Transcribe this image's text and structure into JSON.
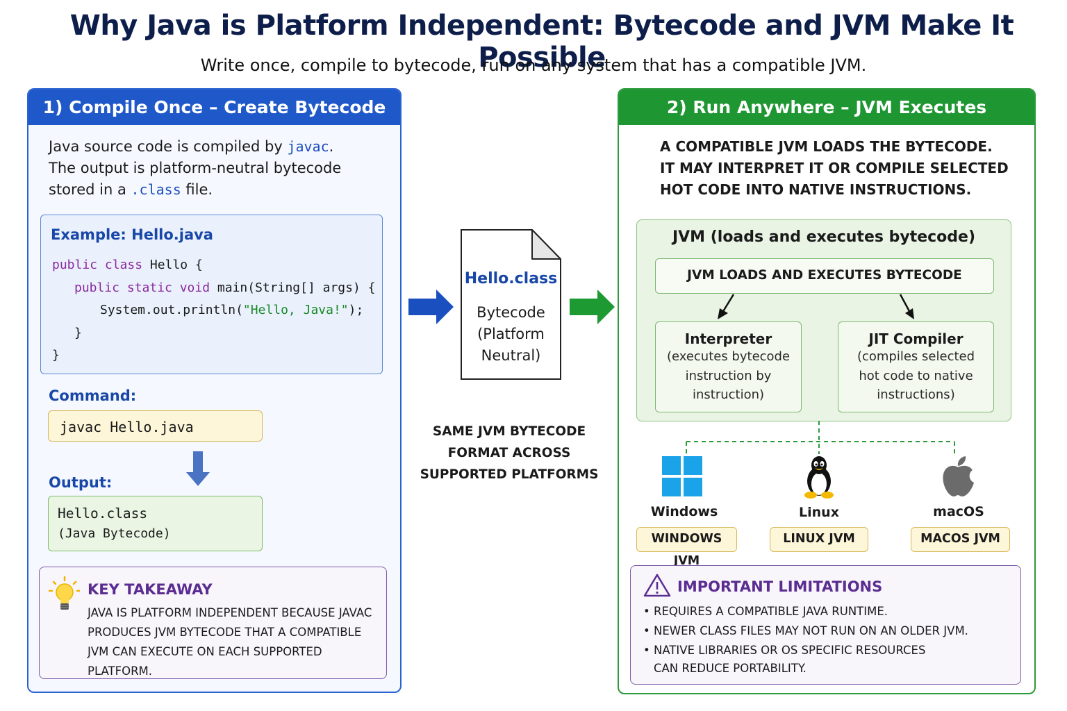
{
  "title": "Why Java is Platform Independent: Bytecode and JVM Make It Possible",
  "subtitle": "Write once, compile to bytecode, run on any system that has a compatible JVM.",
  "left": {
    "header": "1) Compile Once – Create Bytecode",
    "intro": {
      "line1_a": "Java source code is compiled by ",
      "line1_code": "javac",
      "line1_b": ".",
      "line2": "The output is platform-neutral bytecode",
      "line3_a": "stored in a ",
      "line3_code": ".class",
      "line3_b": " file."
    },
    "example": {
      "title": "Example: Hello.java",
      "code": {
        "l1_kw": "public class",
        "l1_rest": " Hello {",
        "l2_kw": "public static void",
        "l2_rest": " main(String[] args) {",
        "l3_a": "System.out.println(",
        "l3_str": "\"Hello, Java!\"",
        "l3_b": ");",
        "l4": "}",
        "l5": "}"
      }
    },
    "command_label": "Command:",
    "command": "javac Hello.java",
    "output_label": "Output:",
    "output_line1": "Hello.class",
    "output_line2": "(Java Bytecode)",
    "takeaway": {
      "title": "KEY TAKEAWAY",
      "line1": "JAVA IS PLATFORM INDEPENDENT BECAUSE JAVAC",
      "line2": "PRODUCES JVM BYTECODE THAT A COMPATIBLE",
      "line3": "JVM CAN EXECUTE ON EACH SUPPORTED PLATFORM."
    }
  },
  "middle": {
    "file_name": "Hello.class",
    "file_desc1": "Bytecode",
    "file_desc2": "(Platform",
    "file_desc3": "Neutral)",
    "note1": "SAME JVM BYTECODE",
    "note2": "FORMAT ACROSS",
    "note3": "SUPPORTED PLATFORMS"
  },
  "right": {
    "header": "2) Run Anywhere – JVM Executes",
    "intro1": "A COMPATIBLE JVM LOADS THE BYTECODE.",
    "intro2": "IT MAY INTERPRET IT OR COMPILE SELECTED",
    "intro3": "HOT CODE INTO NATIVE INSTRUCTIONS.",
    "jvm_title": "JVM (loads and executes bytecode)",
    "jvm_inner": "JVM LOADS AND EXECUTES BYTECODE",
    "interpreter": {
      "title": "Interpreter",
      "d1": "(executes bytecode",
      "d2": "instruction by",
      "d3": "instruction)"
    },
    "jit": {
      "title": "JIT Compiler",
      "d1": "(compiles selected",
      "d2": "hot code to native",
      "d3": "instructions)"
    },
    "platforms": [
      {
        "name": "Windows",
        "jvm": "WINDOWS JVM",
        "icon": "windows-logo-icon",
        "color": "#1aa3e8"
      },
      {
        "name": "Linux",
        "jvm": "LINUX JVM",
        "icon": "tux-penguin-icon",
        "color": "#111111"
      },
      {
        "name": "macOS",
        "jvm": "MACOS JVM",
        "icon": "apple-logo-icon",
        "color": "#6b6b6b"
      }
    ],
    "limits": {
      "title": "IMPORTANT LIMITATIONS",
      "item1": "REQUIRES A COMPATIBLE JAVA RUNTIME.",
      "item2": "NEWER CLASS FILES MAY NOT RUN ON AN OLDER JVM.",
      "item3a": "NATIVE LIBRARIES OR OS SPECIFIC RESOURCES",
      "item3b": "CAN REDUCE PORTABILITY."
    }
  },
  "colors": {
    "blue_header": "#1f58c8",
    "green_header": "#1e9632",
    "blue_arrow": "#1a4fc0",
    "green_arrow": "#1e9a32",
    "purple": "#5b2d91"
  }
}
